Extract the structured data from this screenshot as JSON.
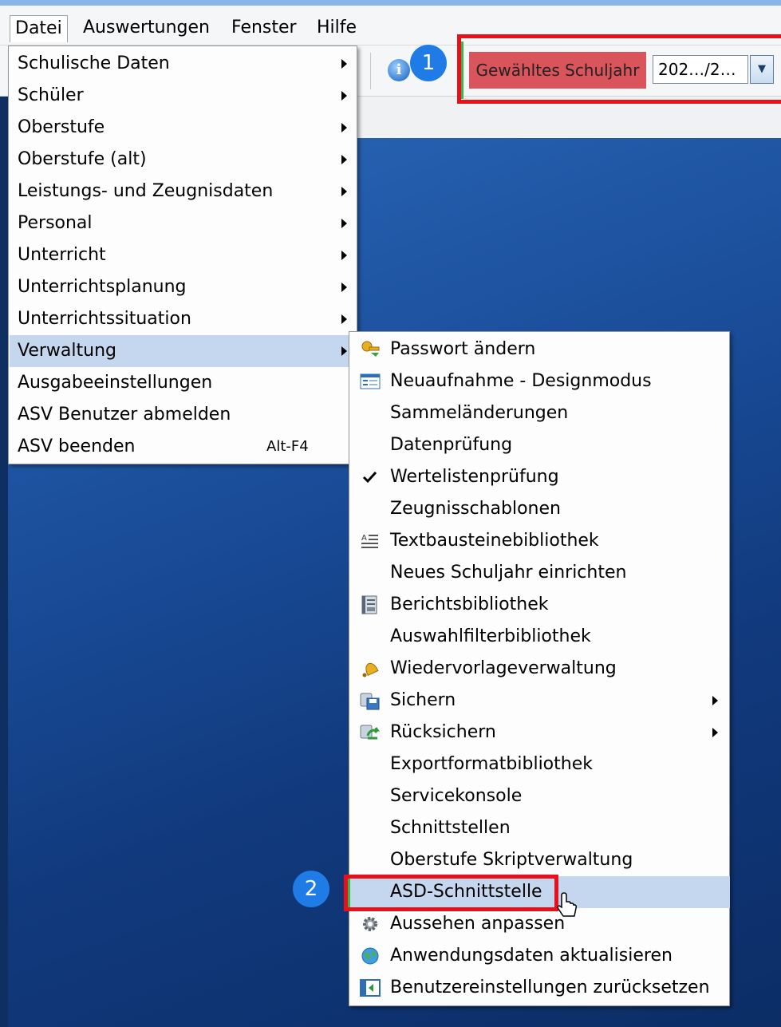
{
  "menubar": {
    "items": [
      "Datei",
      "Auswertungen",
      "Fenster",
      "Hilfe"
    ]
  },
  "toolbar": {
    "school_year_label": "Gewähltes Schuljahr",
    "school_year_value": "202…/2…",
    "badge1": "1",
    "badge2": "2"
  },
  "file_menu": {
    "items": [
      "Schulische Daten",
      "Schüler",
      "Oberstufe",
      "Oberstufe (alt)",
      "Leistungs- und Zeugnisdaten",
      "Personal",
      "Unterricht",
      "Unterrichtsplanung",
      "Unterrichtssituation",
      "Verwaltung",
      "Ausgabeeinstellungen",
      "ASV Benutzer abmelden",
      "ASV beenden"
    ],
    "shortcut_beenden": "Alt-F4"
  },
  "verwaltung_menu": {
    "items": [
      "Passwort ändern",
      "Neuaufnahme - Designmodus",
      "Sammeländerungen",
      "Datenprüfung",
      "Wertelistenprüfung",
      "Zeugnisschablonen",
      "Textbausteinebibliothek",
      "Neues Schuljahr einrichten",
      "Berichtsbibliothek",
      "Auswahlfilterbibliothek",
      "Wiedervorlageverwaltung",
      "Sichern",
      "Rücksichern",
      "Exportformatbibliothek",
      "Servicekonsole",
      "Schnittstellen",
      "Oberstufe Skriptverwaltung",
      "ASD-Schnittstelle",
      "Aussehen anpassen",
      "Anwendungsdaten aktualisieren",
      "Benutzereinstellungen zurücksetzen"
    ]
  },
  "colors": {
    "highlight": "#c5d7ee",
    "annotation_red": "#e8101a",
    "badge_blue": "#1f7ce6",
    "year_label_bg": "#d9545b"
  }
}
